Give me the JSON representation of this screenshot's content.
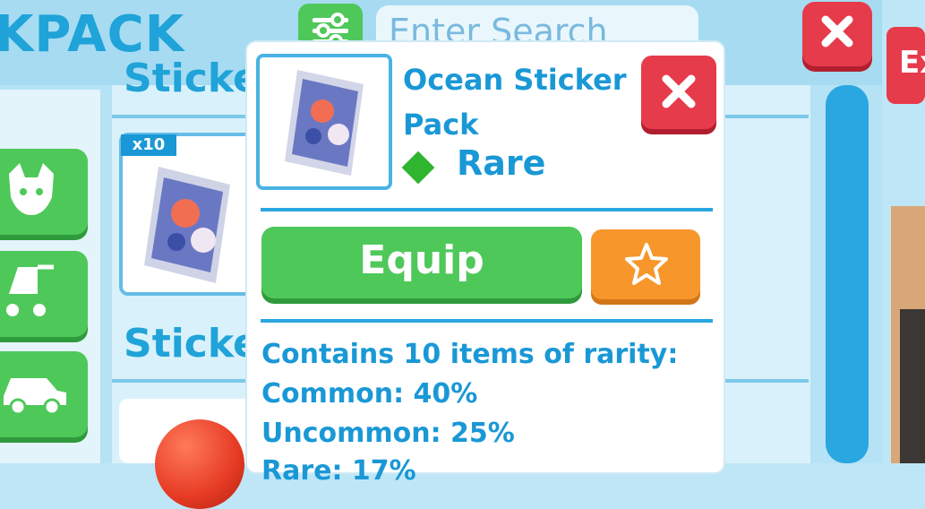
{
  "header": {
    "title": "KPACK",
    "search_placeholder": "Enter Search"
  },
  "backpack": {
    "section_top": "Sticke",
    "section_bottom": "Sticke",
    "item_badge": "x10"
  },
  "popup": {
    "item_name": "Ocean Sticker Pack",
    "rarity": "Rare",
    "rarity_color": "#2fb52f",
    "equip_label": "Equip",
    "contents_title": "Contains 10 items of rarity:",
    "odds": [
      {
        "text": "Common: 40%"
      },
      {
        "text": "Uncommon: 25%"
      },
      {
        "text": "Rare: 17%"
      }
    ]
  },
  "side_right": {
    "label": "Ex"
  },
  "colors": {
    "accent": "#1a98d6",
    "green_button": "#4fc85a",
    "red_button": "#e63b4b",
    "orange_button": "#f7962a"
  },
  "icons": {
    "filter": "sliders-icon",
    "close": "close-icon",
    "favorite": "star-icon",
    "rarity": "diamond-icon",
    "categories": [
      "pet-icon",
      "stroller-icon",
      "car-icon"
    ]
  }
}
